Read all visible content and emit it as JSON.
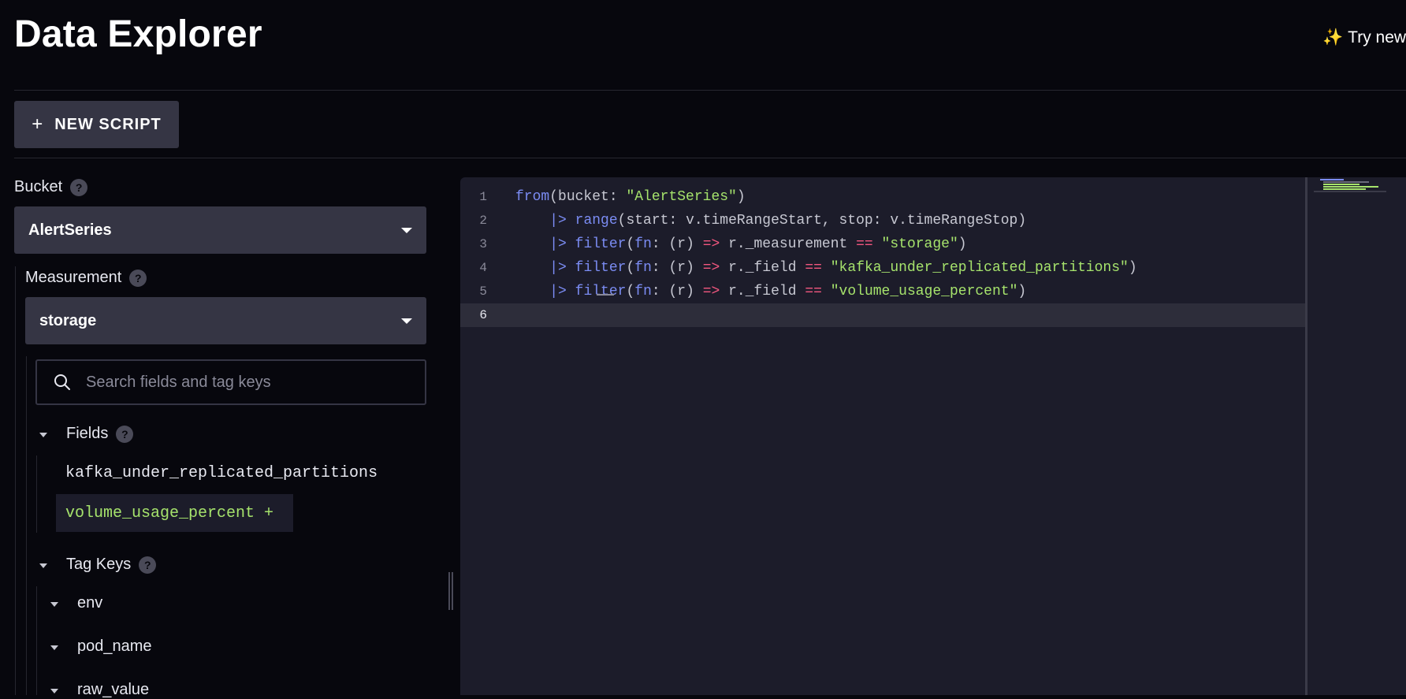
{
  "header": {
    "title": "Data Explorer",
    "try_new": "Try new"
  },
  "toolbar": {
    "new_script_label": "NEW SCRIPT"
  },
  "bucket": {
    "label": "Bucket",
    "selected": "AlertSeries"
  },
  "measurement": {
    "label": "Measurement",
    "selected": "storage"
  },
  "search": {
    "placeholder": "Search fields and tag keys"
  },
  "fields": {
    "label": "Fields",
    "items": [
      "kafka_under_replicated_partitions",
      "volume_usage_percent +"
    ]
  },
  "tag_keys": {
    "label": "Tag Keys",
    "items": [
      "env",
      "pod_name",
      "raw_value"
    ]
  },
  "editor": {
    "line_numbers": [
      "1",
      "2",
      "3",
      "4",
      "5",
      "6"
    ],
    "lines": [
      "from(bucket: \"AlertSeries\")",
      "    |> range(start: v.timeRangeStart, stop: v.timeRangeStop)",
      "    |> filter(fn: (r) => r._measurement == \"storage\")",
      "    |> filter(fn: (r) => r._field == \"kafka_under_replicated_partitions\")",
      "    |> filter(fn: (r) => r._field == \"volume_usage_percent\")",
      ""
    ]
  },
  "colors": {
    "background": "#07070d",
    "panel": "#353544",
    "editor_bg": "#1c1c2a",
    "keyword": "#7b8cf3",
    "operator": "#f2577f",
    "string": "#a6e36c"
  }
}
